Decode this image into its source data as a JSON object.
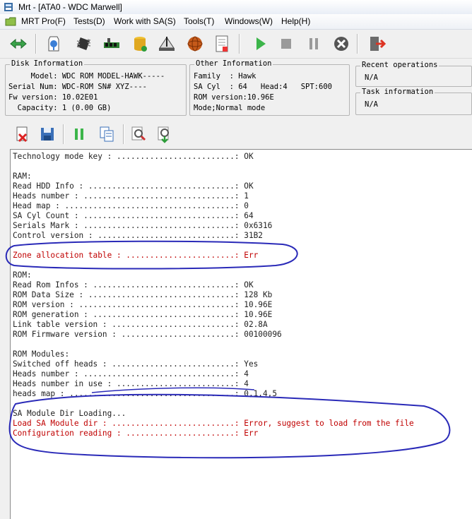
{
  "window": {
    "title": "Mrt - [ATA0 - WDC Marwell]"
  },
  "menu": [
    "MRT Pro(F)",
    "Tests(D)",
    "Work with SA(S)",
    "Tools(T)",
    "Windows(W)",
    "Help(H)"
  ],
  "toolbar_icons": [
    "connect-icon",
    "info-icon",
    "chip-icon",
    "memory-icon",
    "database-icon",
    "scale-icon",
    "sphere-icon",
    "document-icon",
    "play-icon",
    "stop-icon",
    "pause-icon",
    "cancel-icon",
    "exit-icon"
  ],
  "disk_info": {
    "title": "Disk Information",
    "lines": [
      "     Model: WDC ROM MODEL-HAWK-----",
      "Serial Num: WDC-ROM SN# XYZ----",
      "Fw version: 10.02E01",
      "  Capacity: 1 (0.00 GB)"
    ]
  },
  "other_info": {
    "title": "Other Information",
    "lines": [
      "Family  : Hawk",
      "SA Cyl  : 64   Head:4   SPT:600",
      "ROM version:10.96E",
      "Mode;Normal mode"
    ]
  },
  "recent_ops": {
    "title": "Recent operations",
    "value": "N/A"
  },
  "task_info": {
    "title": "Task information",
    "value": "N/A"
  },
  "toolbar2_icons": [
    "delete-file-icon",
    "save-icon",
    "pause-bars-icon",
    "copy-icon",
    "zoom-icon",
    "zoom-down-icon"
  ],
  "log": [
    {
      "text": "Technology mode key : .........................: OK",
      "err": false
    },
    {
      "text": "",
      "err": false
    },
    {
      "text": "RAM:",
      "err": false
    },
    {
      "text": "Read HDD Info : ...............................: OK",
      "err": false
    },
    {
      "text": "Heads number : ................................: 1",
      "err": false
    },
    {
      "text": "Head map : ....................................: 0",
      "err": false
    },
    {
      "text": "SA Cyl Count : ................................: 64",
      "err": false
    },
    {
      "text": "Serials Mark : ................................: 0x6316",
      "err": false
    },
    {
      "text": "Control version : .............................: 31B2",
      "err": false
    },
    {
      "text": "",
      "err": false
    },
    {
      "text": "Zone allocation table : .......................: Err",
      "err": true
    },
    {
      "text": "",
      "err": false
    },
    {
      "text": "ROM:",
      "err": false
    },
    {
      "text": "Read Rom Infos : ..............................: OK",
      "err": false
    },
    {
      "text": "ROM Data Size : ...............................: 128 Kb",
      "err": false
    },
    {
      "text": "ROM version : .................................: 10.96E",
      "err": false
    },
    {
      "text": "ROM generation : ..............................: 10.96E",
      "err": false
    },
    {
      "text": "Link table version : ..........................: 02.8A",
      "err": false
    },
    {
      "text": "ROM Firmware version : ........................: 00100096",
      "err": false
    },
    {
      "text": "",
      "err": false
    },
    {
      "text": "ROM Modules:",
      "err": false
    },
    {
      "text": "Switched off heads : ..........................: Yes",
      "err": false
    },
    {
      "text": "Heads number : ................................: 4",
      "err": false
    },
    {
      "text": "Heads number in use : .........................: 4",
      "err": false
    },
    {
      "text": "heads map : ...................................: 0,1,4,5",
      "err": false
    },
    {
      "text": "",
      "err": false
    },
    {
      "text": "SA Module Dir Loading...",
      "err": false
    },
    {
      "text": "Load SA Module dir : ..........................: Error, suggest to load from the file",
      "err": true
    },
    {
      "text": "Configuration reading : .......................: Err",
      "err": true
    }
  ],
  "colors": {
    "error_text": "#c00000",
    "annotation_ink": "#2a2ab8"
  }
}
